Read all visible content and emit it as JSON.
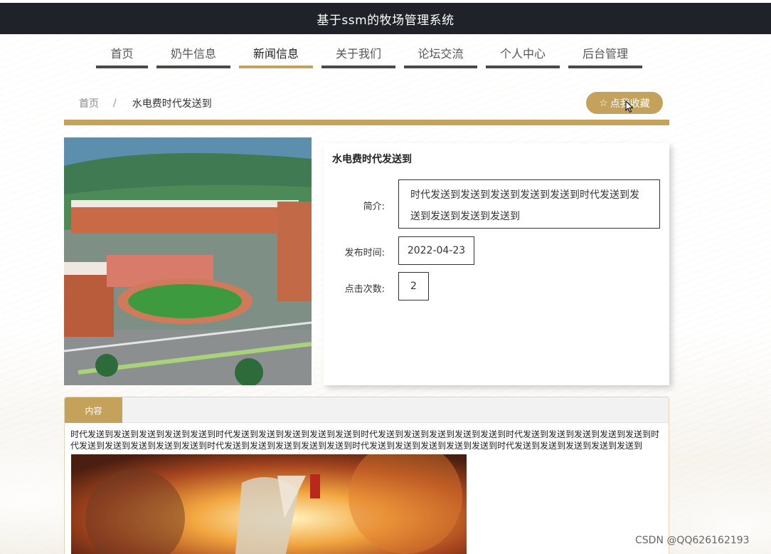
{
  "header": {
    "title": "基于ssm的牧场管理系统"
  },
  "nav": {
    "items": [
      {
        "label": "首页",
        "active": false
      },
      {
        "label": "奶牛信息",
        "active": false
      },
      {
        "label": "新闻信息",
        "active": true
      },
      {
        "label": "关于我们",
        "active": false
      },
      {
        "label": "论坛交流",
        "active": false
      },
      {
        "label": "个人中心",
        "active": false
      },
      {
        "label": "后台管理",
        "active": false
      }
    ]
  },
  "breadcrumb": {
    "home": "首页",
    "separator": "/",
    "current": "水电费时代发送到"
  },
  "favorite_button": {
    "label": "点我收藏",
    "icon": "star-outline-icon"
  },
  "detail": {
    "title": "水电费时代发送到",
    "intro_label": "简介:",
    "intro_value": "时代发送到发送到发送到发送到发送到时代发送到发送到发送到发送到发送到",
    "date_label": "发布时间:",
    "date_value": "2022-04-23",
    "clicks_label": "点击次数:",
    "clicks_value": "2"
  },
  "content": {
    "tab_label": "内容",
    "text": "时代发送到发送到发送到发送到发送到时代发送到发送到发送到发送到发送到时代发送到发送到发送到发送到发送到时代发送到发送到发送到发送到发送到时代发送到发送到发送到发送到发送到时代发送到发送到发送到发送到发送到时代发送到发送到发送到发送到发送到时代发送到发送到发送到发送到发送到"
  },
  "watermark": "CSDN @QQ626162193",
  "colors": {
    "accent": "#c4a25b",
    "header_bg": "#1f2329",
    "nav_bar": "#4a4a4a"
  }
}
